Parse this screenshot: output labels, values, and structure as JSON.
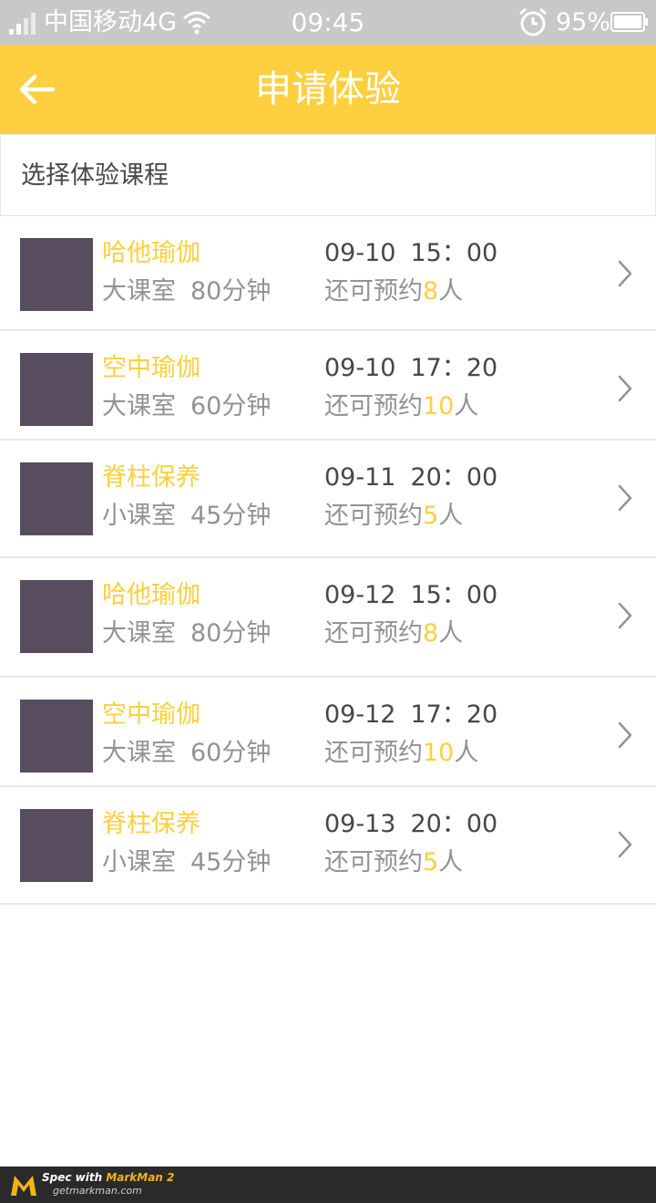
{
  "status_bar": {
    "carrier": "中国移动4G",
    "time": "09:45",
    "battery": "95%",
    "icons": [
      "signal-icon",
      "wifi-icon",
      "alarm-icon",
      "battery-icon"
    ]
  },
  "header": {
    "title": "申请体验",
    "back_icon": "back-arrow-icon",
    "color": "#fecf3f",
    "title_color": "#ffffff"
  },
  "section": {
    "label": "选择体验课程",
    "label_color": "#474747"
  },
  "courses": [
    {
      "name": "哈他瑜伽",
      "room": "大课室",
      "duration": "80分钟",
      "date": "09-10",
      "time": "15：00",
      "avail_prefix": "还可预约",
      "avail_count": "8",
      "avail_suffix": "人"
    },
    {
      "name": "空中瑜伽",
      "room": "大课室",
      "duration": "60分钟",
      "date": "09-10",
      "time": "17：20",
      "avail_prefix": "还可预约",
      "avail_count": "10",
      "avail_suffix": "人"
    },
    {
      "name": "脊柱保养",
      "room": "小课室",
      "duration": "45分钟",
      "date": "09-11",
      "time": "20：00",
      "avail_prefix": "还可预约",
      "avail_count": "5",
      "avail_suffix": "人"
    },
    {
      "name": "哈他瑜伽",
      "room": "大课室",
      "duration": "80分钟",
      "date": "09-12",
      "time": "15：00",
      "avail_prefix": "还可预约",
      "avail_count": "8",
      "avail_suffix": "人"
    },
    {
      "name": "空中瑜伽",
      "room": "大课室",
      "duration": "60分钟",
      "date": "09-12",
      "time": "17：20",
      "avail_prefix": "还可预约",
      "avail_count": "10",
      "avail_suffix": "人"
    },
    {
      "name": "脊柱保养",
      "room": "小课室",
      "duration": "45分钟",
      "date": "09-13",
      "time": "20：00",
      "avail_prefix": "还可预约",
      "avail_count": "5",
      "avail_suffix": "人"
    }
  ],
  "colors": {
    "accent": "#fecf3f",
    "secondary_text": "#939393",
    "primary_text": "#474747",
    "thumbnail": "#574d5e"
  },
  "footer": {
    "brand_prefix": "Spec with ",
    "brand_name": "MarkMan 2",
    "url": "getmarkman.com"
  }
}
